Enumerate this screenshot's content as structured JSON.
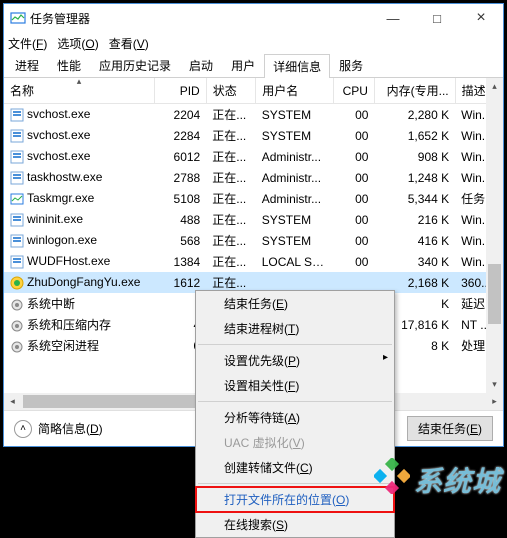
{
  "titlebar": {
    "title": "任务管理器"
  },
  "menubar": {
    "file": "文件(<u>F</u>)",
    "options": "选项(<u>O</u>)",
    "view": "查看(<u>V</u>)"
  },
  "tabs": [
    "进程",
    "性能",
    "应用历史记录",
    "启动",
    "用户",
    "详细信息",
    "服务"
  ],
  "active_tab": 5,
  "columns": [
    "名称",
    "PID",
    "状态",
    "用户名",
    "CPU",
    "内存(专用...",
    "描述"
  ],
  "rows": [
    {
      "icon": "svc",
      "name": "svchost.exe",
      "pid": "2204",
      "status": "正在...",
      "user": "SYSTEM",
      "cpu": "00",
      "mem": "2,280 K",
      "desc": "Win..."
    },
    {
      "icon": "svc",
      "name": "svchost.exe",
      "pid": "2284",
      "status": "正在...",
      "user": "SYSTEM",
      "cpu": "00",
      "mem": "1,652 K",
      "desc": "Win..."
    },
    {
      "icon": "svc",
      "name": "svchost.exe",
      "pid": "6012",
      "status": "正在...",
      "user": "Administr...",
      "cpu": "00",
      "mem": "908 K",
      "desc": "Win..."
    },
    {
      "icon": "svc",
      "name": "taskhostw.exe",
      "pid": "2788",
      "status": "正在...",
      "user": "Administr...",
      "cpu": "00",
      "mem": "1,248 K",
      "desc": "Win..."
    },
    {
      "icon": "tm",
      "name": "Taskmgr.exe",
      "pid": "5108",
      "status": "正在...",
      "user": "Administr...",
      "cpu": "00",
      "mem": "5,344 K",
      "desc": "任务..."
    },
    {
      "icon": "svc",
      "name": "wininit.exe",
      "pid": "488",
      "status": "正在...",
      "user": "SYSTEM",
      "cpu": "00",
      "mem": "216 K",
      "desc": "Win..."
    },
    {
      "icon": "svc",
      "name": "winlogon.exe",
      "pid": "568",
      "status": "正在...",
      "user": "SYSTEM",
      "cpu": "00",
      "mem": "416 K",
      "desc": "Win..."
    },
    {
      "icon": "svc",
      "name": "WUDFHost.exe",
      "pid": "1384",
      "status": "正在...",
      "user": "LOCAL SE...",
      "cpu": "00",
      "mem": "340 K",
      "desc": "Win..."
    },
    {
      "icon": "360",
      "name": "ZhuDongFangYu.exe",
      "pid": "1612",
      "status": "正在...",
      "user": "",
      "cpu": "",
      "mem": "2,168 K",
      "desc": "360...",
      "selected": true
    },
    {
      "icon": "gear",
      "name": "系统中断",
      "pid": "-",
      "status": "",
      "user": "",
      "cpu": "",
      "mem": "K",
      "desc": "延迟..."
    },
    {
      "icon": "gear",
      "name": "系统和压缩内存",
      "pid": "4",
      "status": "",
      "user": "",
      "cpu": "",
      "mem": "17,816 K",
      "desc": "NT ..."
    },
    {
      "icon": "gear",
      "name": "系统空闲进程",
      "pid": "0",
      "status": "",
      "user": "",
      "cpu": "",
      "mem": "8 K",
      "desc": "处理..."
    }
  ],
  "footer": {
    "fewer": "简略信息(<u>D</u>)",
    "end_task": "结束任务(<u>E</u>)"
  },
  "context_menu": [
    {
      "label": "结束任务(<u>E</u>)",
      "type": "item"
    },
    {
      "label": "结束进程树(<u>T</u>)",
      "type": "item"
    },
    {
      "type": "sep"
    },
    {
      "label": "设置优先级(<u>P</u>)",
      "type": "sub"
    },
    {
      "label": "设置相关性(<u>F</u>)",
      "type": "item"
    },
    {
      "type": "sep"
    },
    {
      "label": "分析等待链(<u>A</u>)",
      "type": "item"
    },
    {
      "label": "UAC 虚拟化(<u>V</u>)",
      "type": "item",
      "disabled": true
    },
    {
      "label": "创建转储文件(<u>C</u>)",
      "type": "item"
    },
    {
      "type": "sep"
    },
    {
      "label": "打开文件所在的位置(<u>O</u>)",
      "type": "item",
      "boxed": true
    },
    {
      "label": "在线搜索(<u>S</u>)",
      "type": "item"
    }
  ],
  "watermark": {
    "text": "系统城"
  }
}
